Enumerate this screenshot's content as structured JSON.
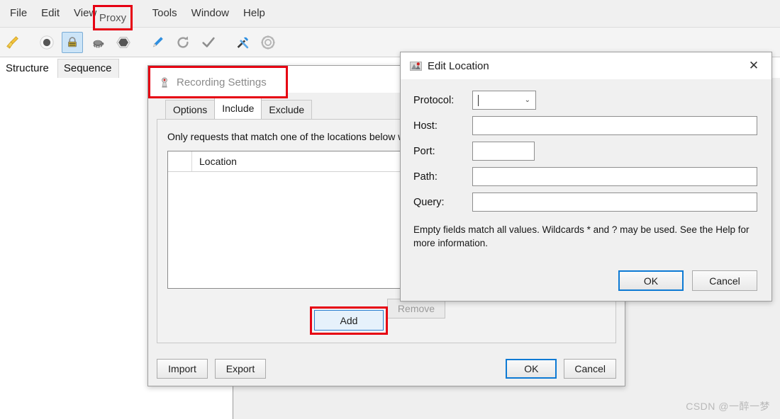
{
  "app": {
    "menubar": [
      {
        "label": "File",
        "icon": null
      },
      {
        "label": "Edit",
        "icon": null
      },
      {
        "label": "View",
        "icon": null
      },
      {
        "label": "Proxy",
        "icon": null,
        "highlighted": true
      },
      {
        "label": "Tools",
        "icon": null
      },
      {
        "label": "Window",
        "icon": null
      },
      {
        "label": "Help",
        "icon": null
      }
    ],
    "toolbar": [
      {
        "name": "clear-broom-icon",
        "glyph": "🧹",
        "selected": false
      },
      {
        "name": "record-icon",
        "glyph": "⚫",
        "selected": false
      },
      {
        "name": "proxy-lock-icon",
        "glyph": "🔒",
        "selected": true
      },
      {
        "name": "throttle-turtle-icon",
        "glyph": "🐢",
        "selected": false
      },
      {
        "name": "stop-hexagon-icon",
        "glyph": "⬢",
        "selected": false
      },
      {
        "name": "compose-pen-icon",
        "glyph": "🖊",
        "selected": false
      },
      {
        "name": "repeat-refresh-icon",
        "glyph": "↻",
        "selected": false
      },
      {
        "name": "validate-check-icon",
        "glyph": "✔",
        "selected": false
      },
      {
        "name": "tools-wrench-icon",
        "glyph": "🔧",
        "selected": false
      },
      {
        "name": "settings-gear-icon",
        "glyph": "⚙",
        "selected": false
      }
    ],
    "view_tabs": [
      {
        "label": "Structure",
        "active": true
      },
      {
        "label": "Sequence",
        "active": false
      }
    ]
  },
  "recording_settings": {
    "title": "Recording Settings",
    "icon": "recording-settings-icon",
    "tabs": [
      {
        "label": "Options",
        "active": false
      },
      {
        "label": "Include",
        "active": true
      },
      {
        "label": "Exclude",
        "active": false
      }
    ],
    "description": "Only requests that match one of the locations below will be recorded. If the list is empty, all requests will be recorded unless otherwise excluded.",
    "table": {
      "columns": [
        "",
        "Location"
      ],
      "rows": []
    },
    "table_buttons": [
      {
        "label": "Add",
        "state": "focused",
        "highlighted": true
      },
      {
        "label": "Remove",
        "state": "disabled",
        "highlighted": false
      }
    ],
    "footer_left": [
      {
        "label": "Import",
        "state": "normal"
      },
      {
        "label": "Export",
        "state": "normal"
      }
    ],
    "footer_right": [
      {
        "label": "OK",
        "state": "default"
      },
      {
        "label": "Cancel",
        "state": "normal"
      }
    ]
  },
  "edit_location": {
    "title": "Edit Location",
    "icon": "edit-location-icon",
    "close_icon": "close-icon",
    "close_glyph": "✕",
    "fields": [
      {
        "label": "Protocol:",
        "name": "protocol",
        "type": "combobox",
        "value": "",
        "placeholder": "",
        "caret": "⌄"
      },
      {
        "label": "Host:",
        "name": "host",
        "type": "text",
        "value": "",
        "placeholder": ""
      },
      {
        "label": "Port:",
        "name": "port",
        "type": "text",
        "value": "",
        "placeholder": ""
      },
      {
        "label": "Path:",
        "name": "path",
        "type": "text",
        "value": "",
        "placeholder": ""
      },
      {
        "label": "Query:",
        "name": "query",
        "type": "text",
        "value": "",
        "placeholder": ""
      }
    ],
    "help_text": "Empty fields match all values. Wildcards * and ? may be used. See the Help for more information.",
    "buttons": [
      {
        "label": "OK",
        "state": "default"
      },
      {
        "label": "Cancel",
        "state": "normal"
      }
    ]
  },
  "annotations": {
    "color": "#e60012",
    "boxes": [
      {
        "name": "proxy-menu-highlight",
        "target": "Proxy"
      },
      {
        "name": "recording-settings-highlight",
        "target": "Recording Settings"
      },
      {
        "name": "add-button-highlight",
        "target": "Add"
      }
    ]
  },
  "watermark": {
    "text": "CSDN @一醉一梦"
  }
}
